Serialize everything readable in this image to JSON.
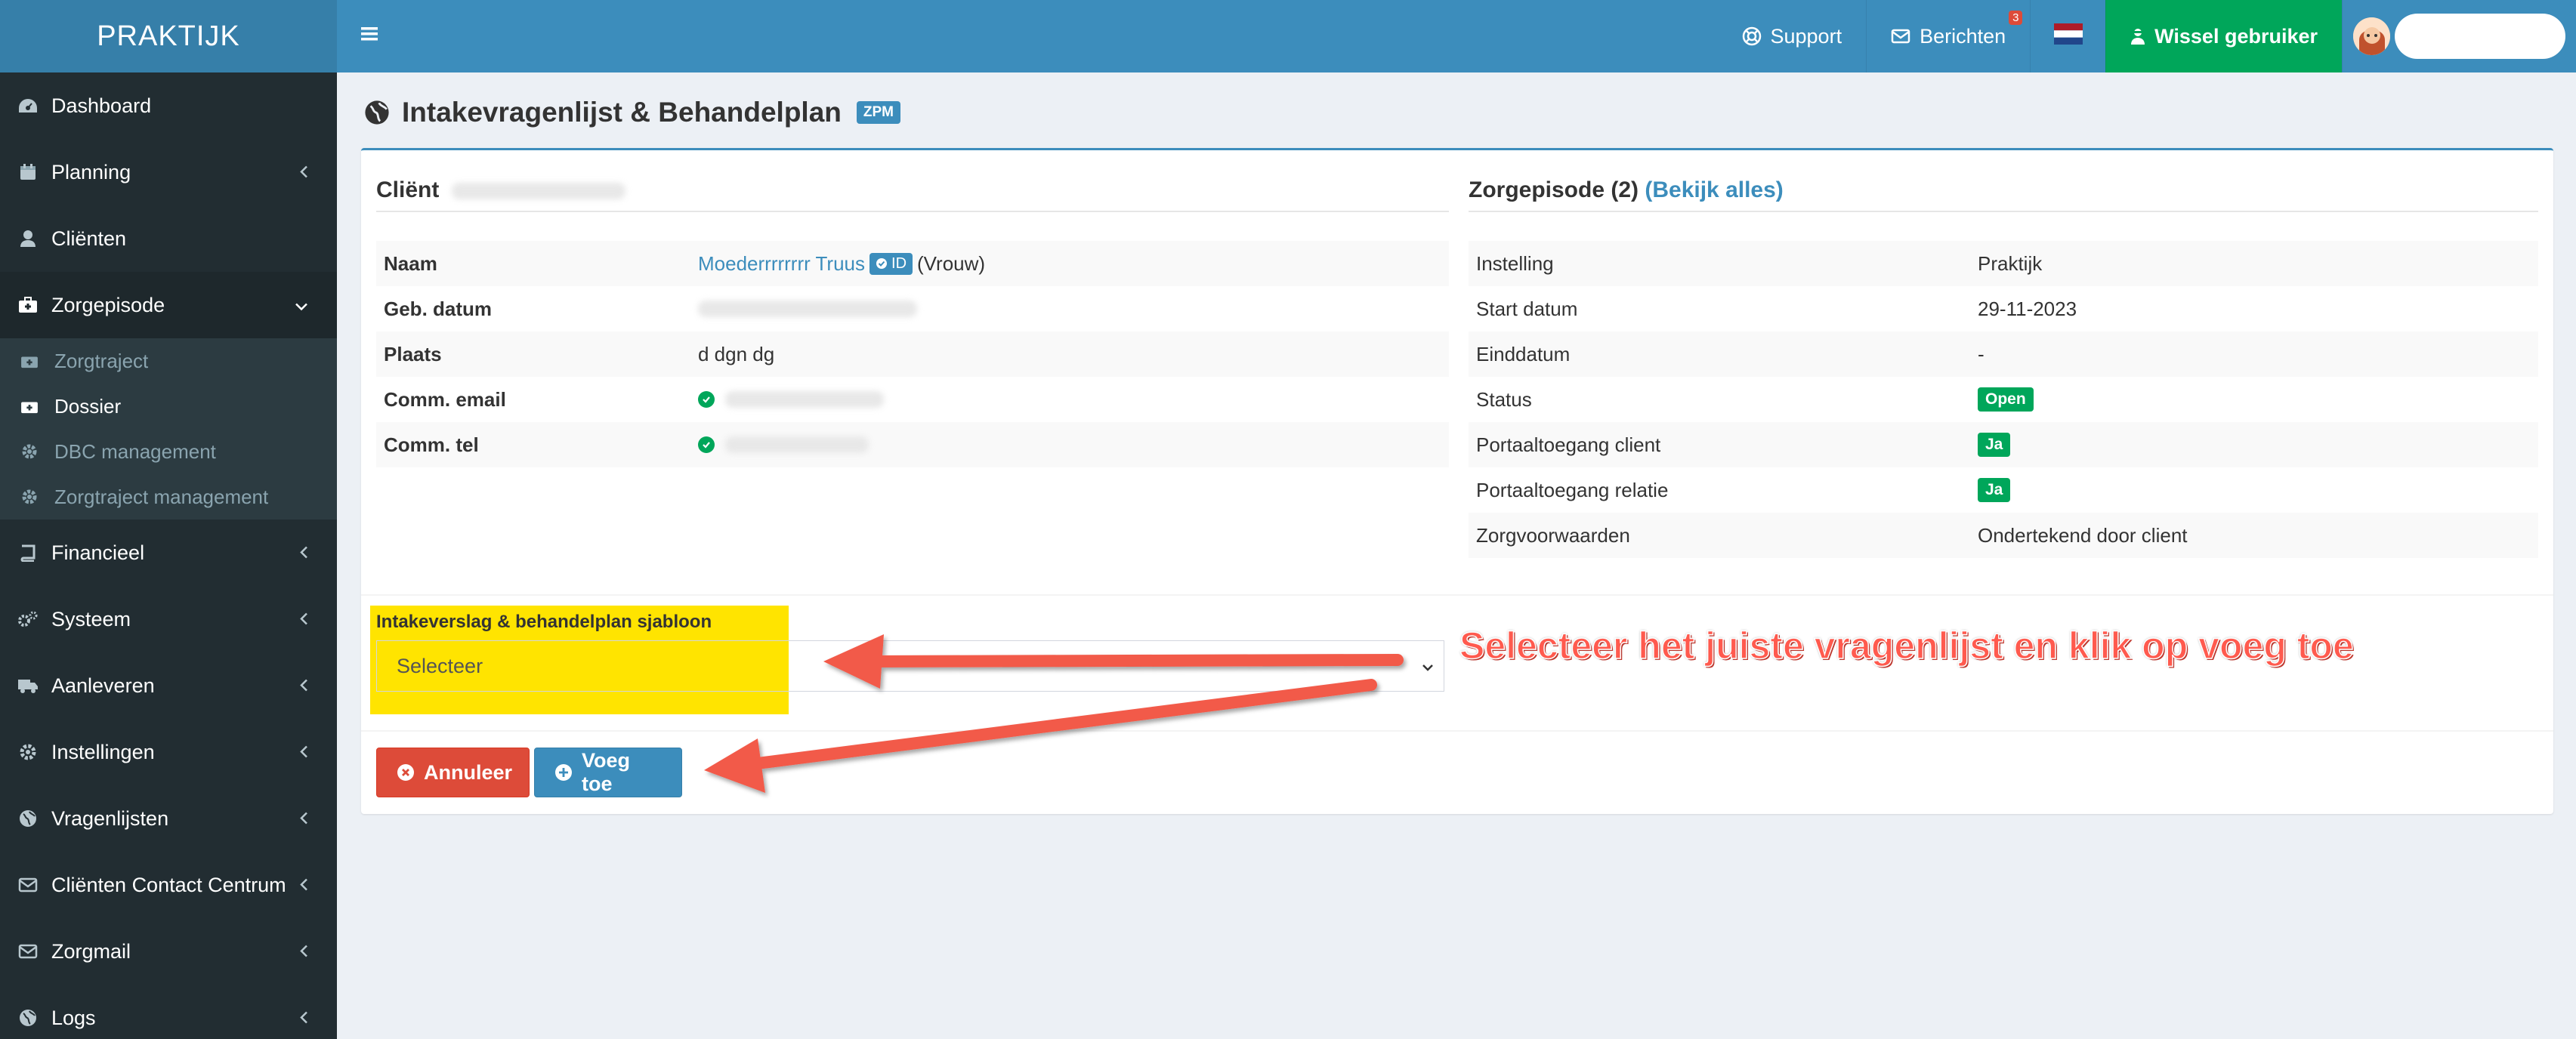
{
  "app": {
    "brand": "PRAKTIJK"
  },
  "sidebar": {
    "items": [
      {
        "label": "Dashboard",
        "icon": "dashboard-icon"
      },
      {
        "label": "Planning",
        "icon": "calendar-icon"
      },
      {
        "label": "Cliënten",
        "icon": "user-icon"
      },
      {
        "label": "Zorgepisode",
        "icon": "medkit-icon"
      },
      {
        "label": "Financieel",
        "icon": "book-icon"
      },
      {
        "label": "Systeem",
        "icon": "cogs-icon"
      },
      {
        "label": "Aanleveren",
        "icon": "truck-icon"
      },
      {
        "label": "Instellingen",
        "icon": "gear-icon"
      },
      {
        "label": "Vragenlijsten",
        "icon": "globe-icon"
      },
      {
        "label": "Cliënten Contact Centrum",
        "icon": "envelope-icon"
      },
      {
        "label": "Zorgmail",
        "icon": "envelope-icon"
      },
      {
        "label": "Logs",
        "icon": "globe-icon"
      }
    ],
    "submenu": [
      {
        "label": "Zorgtraject",
        "icon": "medkit-icon"
      },
      {
        "label": "Dossier",
        "icon": "medkit-icon"
      },
      {
        "label": "DBC management",
        "icon": "gear-icon"
      },
      {
        "label": "Zorgtraject management",
        "icon": "gear-icon"
      }
    ]
  },
  "header": {
    "support": "Support",
    "berichten": "Berichten",
    "berichten_count": "3",
    "wissel": "Wissel gebruiker"
  },
  "page": {
    "title": "Intakevragenlijst & Behandelplan",
    "badge": "ZPM"
  },
  "client": {
    "title": "Cliënt",
    "rows": {
      "naam_label": "Naam",
      "naam_value": "Moederrrrrrrr Truus",
      "id_badge": "ID",
      "gender": "(Vrouw)",
      "geb_label": "Geb. datum",
      "plaats_label": "Plaats",
      "plaats_value": "d dgn dg",
      "email_label": "Comm. email",
      "tel_label": "Comm. tel"
    }
  },
  "episode": {
    "title": "Zorgepisode (2)",
    "link": "(Bekijk alles)",
    "rows": [
      {
        "label": "Instelling",
        "value": "Praktijk"
      },
      {
        "label": "Start datum",
        "value": "29-11-2023"
      },
      {
        "label": "Einddatum",
        "value": "-"
      },
      {
        "label": "Status",
        "value": "Open"
      },
      {
        "label": "Portaaltoegang client",
        "value": "Ja"
      },
      {
        "label": "Portaaltoegang relatie",
        "value": "Ja"
      },
      {
        "label": "Zorgvoorwaarden",
        "value": "Ondertekend door client"
      }
    ]
  },
  "form": {
    "label": "Intakeverslag & behandelplan sjabloon",
    "select_value": "Selecteer",
    "cancel": "Annuleer",
    "add": "Voeg toe"
  },
  "annotation": "Selecteer het juiste vragenlijst en klik op voeg toe",
  "colors": {
    "primary": "#3c8dbc",
    "sidebar": "#222d32",
    "success": "#00a65a",
    "danger": "#dd4b39",
    "highlight": "#ffe400",
    "annotation": "#ff5a4e"
  }
}
